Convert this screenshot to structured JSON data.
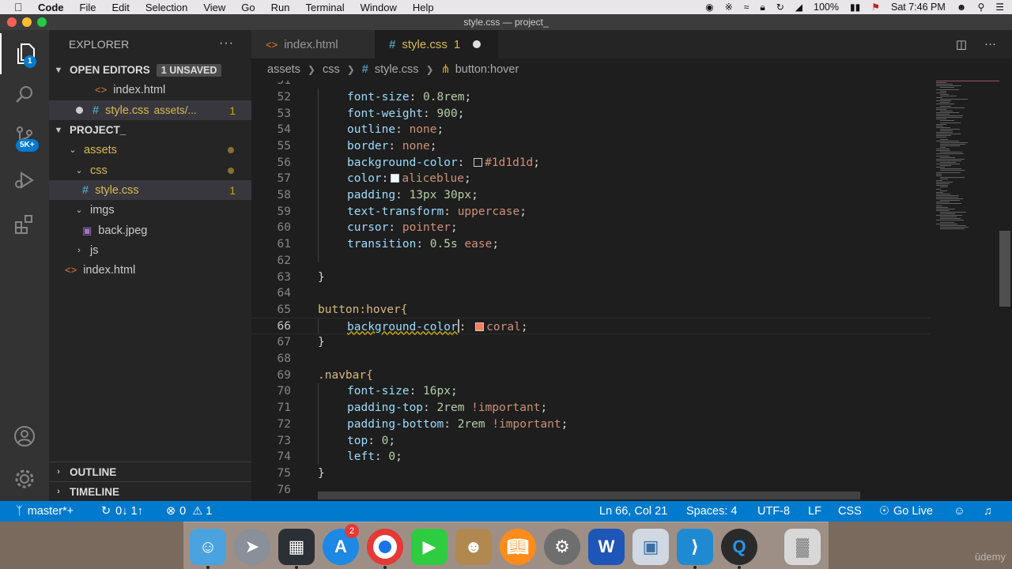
{
  "menubar": {
    "app": "Code",
    "items": [
      "File",
      "Edit",
      "Selection",
      "View",
      "Go",
      "Run",
      "Terminal",
      "Window",
      "Help"
    ],
    "battery": "100%",
    "clock": "Sat 7:46 PM"
  },
  "window": {
    "title": "style.css — project_"
  },
  "activity": {
    "explorer_badge": "1",
    "scm_badge": "5K+"
  },
  "sidebar": {
    "title": "EXPLORER",
    "more": "···",
    "open_editors": "OPEN EDITORS",
    "unsaved_badge": "1 UNSAVED",
    "open_files": [
      {
        "name": "index.html"
      },
      {
        "name": "style.css",
        "path": "assets/...",
        "count": "1"
      }
    ],
    "project": "PROJECT_",
    "tree": {
      "assets": "assets",
      "css": "css",
      "style": "style.css",
      "style_count": "1",
      "imgs": "imgs",
      "back": "back.jpeg",
      "js": "js",
      "index": "index.html"
    },
    "outline": "OUTLINE",
    "timeline": "TIMELINE"
  },
  "tabs": [
    {
      "label": "index.html"
    },
    {
      "label": "style.css",
      "count": "1"
    }
  ],
  "breadcrumb": [
    "assets",
    "css",
    "style.css",
    "button:hover"
  ],
  "editor": {
    "first_line": "51",
    "line_numbers": [
      "52",
      "53",
      "54",
      "55",
      "56",
      "57",
      "58",
      "59",
      "60",
      "61",
      "62",
      "63",
      "64",
      "65",
      "66",
      "67",
      "68",
      "69",
      "70",
      "71",
      "72",
      "73",
      "74",
      "75",
      "76"
    ],
    "lines": {
      "l52": {
        "prop": "font-size",
        "val": "0.8rem"
      },
      "l53": {
        "prop": "font-weight",
        "val": "900"
      },
      "l54": {
        "prop": "outline",
        "val": "none"
      },
      "l55": {
        "prop": "border",
        "val": "none"
      },
      "l56": {
        "prop": "background-color",
        "val": "#1d1d1d",
        "swatch": "#1d1d1d"
      },
      "l57": {
        "prop": "color",
        "val": "aliceblue",
        "swatch": "#f0f8ff"
      },
      "l58": {
        "prop": "padding",
        "val": "13px 30px"
      },
      "l59": {
        "prop": "text-transform",
        "val": "uppercase"
      },
      "l60": {
        "prop": "cursor",
        "val": "pointer"
      },
      "l61": {
        "prop": "transition",
        "val1": "0.5s",
        "val2": "ease"
      },
      "l63": "}",
      "l65": "button:hover{",
      "l66": {
        "prop1": "background-colo",
        "prop2": "r",
        "val": "coral",
        "swatch": "#ff7f50"
      },
      "l67": "}",
      "l69": ".navbar{",
      "l70": {
        "prop": "font-size",
        "val": "16px"
      },
      "l71": {
        "prop": "padding-top",
        "val1": "2rem",
        "val2": "!important"
      },
      "l72": {
        "prop": "padding-bottom",
        "val1": "2rem",
        "val2": "!important"
      },
      "l73": {
        "prop": "top",
        "val": "0"
      },
      "l74": {
        "prop": "left",
        "val": "0"
      },
      "l75": "}"
    }
  },
  "statusbar": {
    "branch": "master*+",
    "sync": "0↓ 1↑",
    "errors": "0",
    "warnings": "1",
    "position": "Ln 66, Col 21",
    "spaces": "Spaces: 4",
    "encoding": "UTF-8",
    "eol": "LF",
    "language": "CSS",
    "golive": "Go Live"
  },
  "dock": {
    "appstore_badge": "2"
  },
  "watermark": "ūdemy",
  "colors": {
    "accent": "#007acc",
    "tab_modified": "#d9ba52",
    "editor_bg": "#1e1e1e"
  }
}
